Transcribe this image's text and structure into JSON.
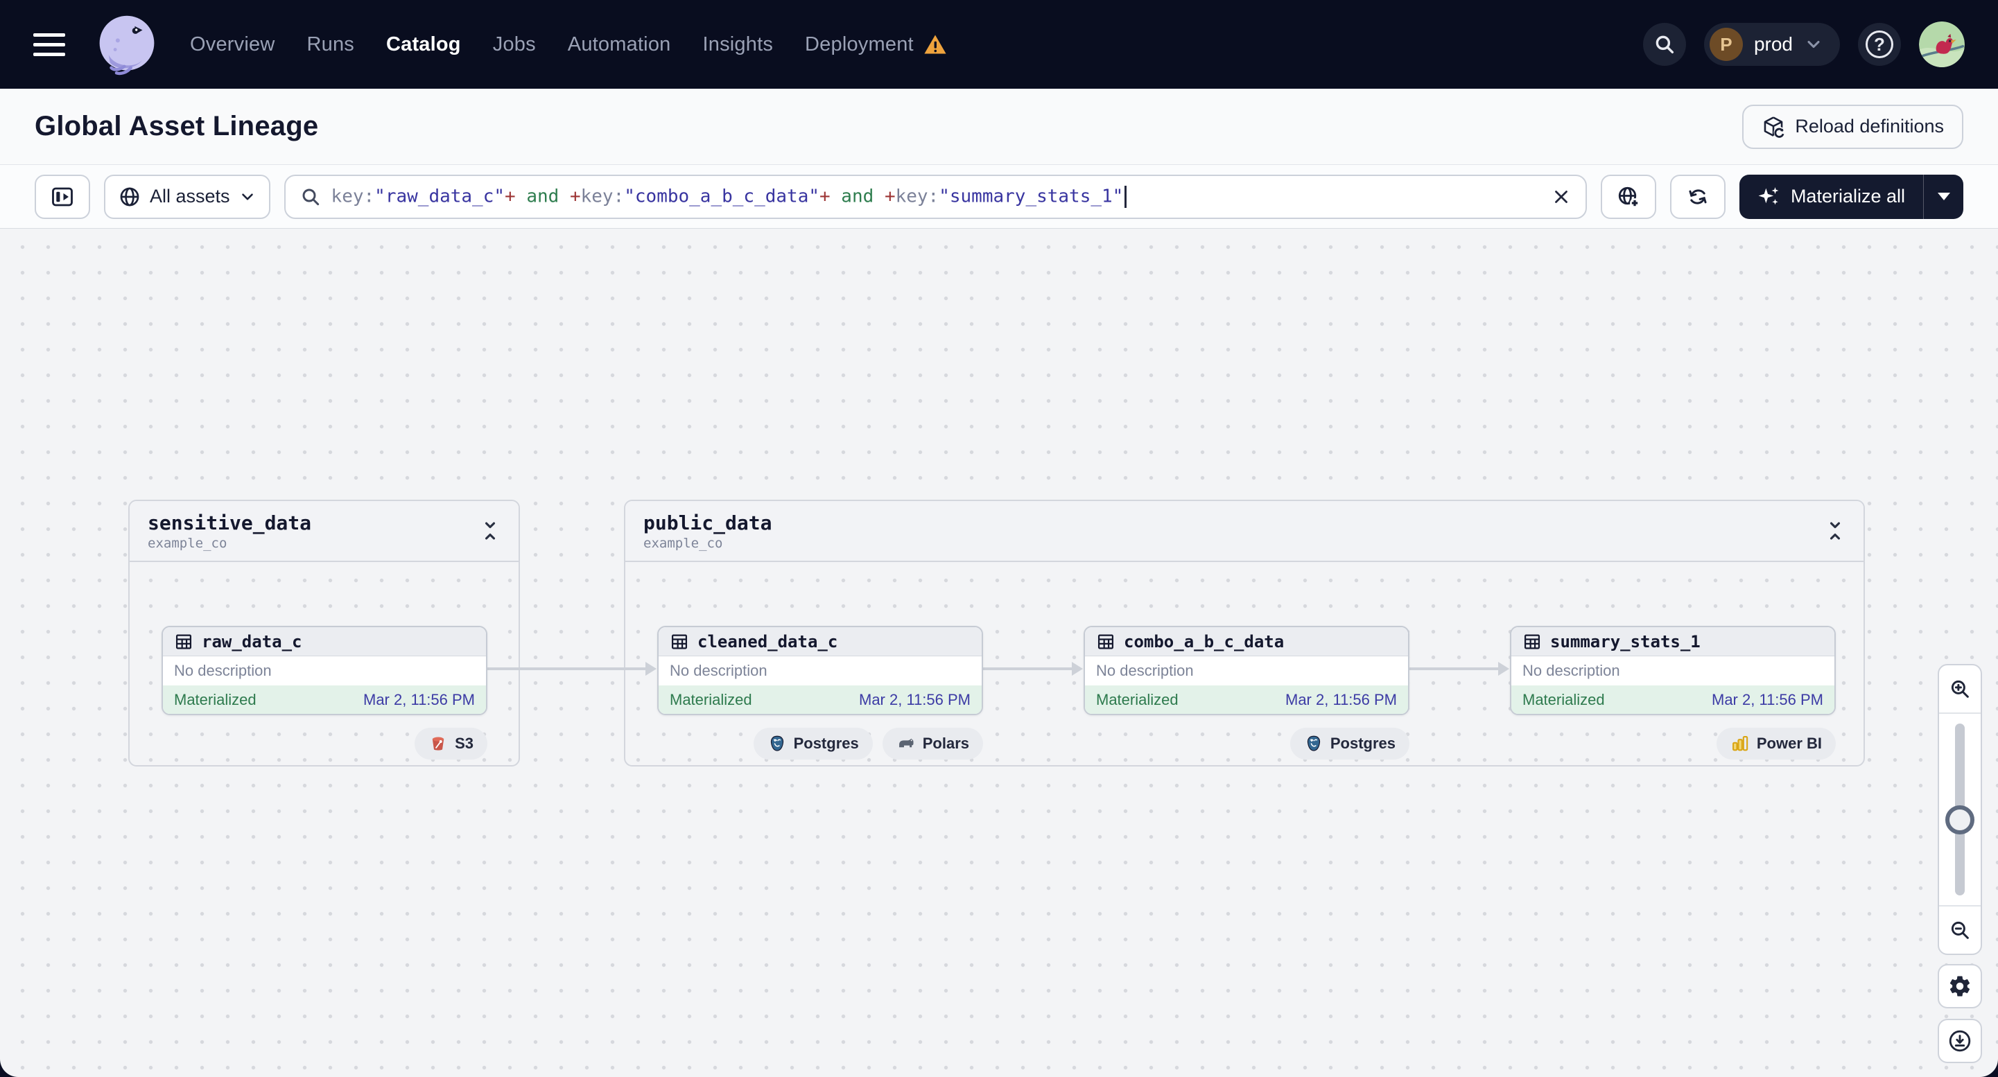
{
  "nav": {
    "items": [
      {
        "label": "Overview",
        "active": false
      },
      {
        "label": "Runs",
        "active": false
      },
      {
        "label": "Catalog",
        "active": true
      },
      {
        "label": "Jobs",
        "active": false
      },
      {
        "label": "Automation",
        "active": false
      },
      {
        "label": "Insights",
        "active": false
      },
      {
        "label": "Deployment",
        "active": false,
        "warning": true
      }
    ],
    "deployment_switcher": {
      "initial": "P",
      "label": "prod"
    },
    "help_label": "?"
  },
  "page_header": {
    "title": "Global Asset Lineage",
    "reload_button": "Reload definitions"
  },
  "toolbar": {
    "filter_button": {
      "label": "All assets"
    },
    "search": {
      "segments": [
        {
          "role": "key",
          "text": "key:"
        },
        {
          "role": "string",
          "text": "\"raw_data_c\""
        },
        {
          "role": "op",
          "text": "+"
        },
        {
          "role": "kw",
          "text": " and "
        },
        {
          "role": "op",
          "text": "+"
        },
        {
          "role": "key",
          "text": "key:"
        },
        {
          "role": "string",
          "text": "\"combo_a_b_c_data\""
        },
        {
          "role": "op",
          "text": "+"
        },
        {
          "role": "kw",
          "text": " and "
        },
        {
          "role": "op",
          "text": "+"
        },
        {
          "role": "key",
          "text": "key:"
        },
        {
          "role": "string",
          "text": "\"summary_stats_1\""
        }
      ]
    },
    "materialize_button": {
      "label": "Materialize all"
    }
  },
  "graph": {
    "groups": [
      {
        "name": "sensitive_data",
        "repo": "example_co"
      },
      {
        "name": "public_data",
        "repo": "example_co"
      }
    ],
    "nodes": [
      {
        "name": "raw_data_c",
        "description": "No description",
        "status": "Materialized",
        "timestamp": "Mar 2, 11:56 PM",
        "group": "sensitive_data",
        "tags": [
          {
            "label": "S3",
            "icon": "s3-bucket-icon"
          }
        ]
      },
      {
        "name": "cleaned_data_c",
        "description": "No description",
        "status": "Materialized",
        "timestamp": "Mar 2, 11:56 PM",
        "group": "public_data",
        "tags": [
          {
            "label": "Postgres",
            "icon": "postgres-icon"
          },
          {
            "label": "Polars",
            "icon": "polars-icon"
          }
        ]
      },
      {
        "name": "combo_a_b_c_data",
        "description": "No description",
        "status": "Materialized",
        "timestamp": "Mar 2, 11:56 PM",
        "group": "public_data",
        "tags": [
          {
            "label": "Postgres",
            "icon": "postgres-icon"
          }
        ]
      },
      {
        "name": "summary_stats_1",
        "description": "No description",
        "status": "Materialized",
        "timestamp": "Mar 2, 11:56 PM",
        "group": "public_data",
        "tags": [
          {
            "label": "Power BI",
            "icon": "power-bi-icon"
          }
        ]
      }
    ],
    "edges": [
      {
        "from": "raw_data_c",
        "to": "cleaned_data_c"
      },
      {
        "from": "cleaned_data_c",
        "to": "combo_a_b_c_data"
      },
      {
        "from": "combo_a_b_c_data",
        "to": "summary_stats_1"
      }
    ]
  },
  "colors": {
    "nav_bg": "#090d1f",
    "warning_orange": "#efa33d",
    "materialized_green": "#2d7a4d",
    "materialized_bg": "#e3f2e9",
    "timestamp_indigo": "#3c3ba5",
    "syntax_string": "#3834a0",
    "syntax_op": "#9d3434",
    "syntax_keyword": "#2e7d4e",
    "syntax_key": "#7b8198"
  }
}
